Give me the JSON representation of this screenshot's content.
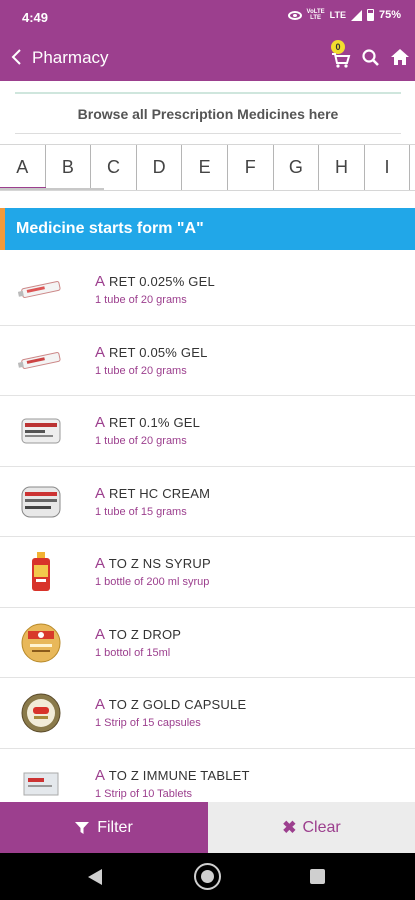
{
  "status_bar": {
    "time": "4:49",
    "network_top": "VoLTE",
    "network_bottom": "LTE",
    "lte": "LTE",
    "battery": "75%"
  },
  "app_bar": {
    "title": "Pharmacy",
    "cart_count": "0"
  },
  "browse": {
    "label": "Browse all Prescription Medicines here"
  },
  "alphabet": [
    "A",
    "B",
    "C",
    "D",
    "E",
    "F",
    "G",
    "H",
    "I"
  ],
  "active_letter": "A",
  "section": {
    "title": "Medicine starts form \"A\""
  },
  "medicines": [
    {
      "first": "A",
      "rest": " RET 0.025% GEL",
      "desc": "1 tube of 20 grams",
      "thumb": "tube-icon"
    },
    {
      "first": "A",
      "rest": " RET 0.05% GEL",
      "desc": "1 tube of 20 grams",
      "thumb": "tube-icon"
    },
    {
      "first": "A",
      "rest": " RET 0.1% GEL",
      "desc": "1 tube of 20 grams",
      "thumb": "box-icon"
    },
    {
      "first": "A",
      "rest": " RET HC CREAM",
      "desc": "1 tube of 15 grams",
      "thumb": "box-icon"
    },
    {
      "first": "A",
      "rest": " TO Z NS SYRUP",
      "desc": "1 bottle of 200 ml syrup",
      "thumb": "bottle-icon"
    },
    {
      "first": "A",
      "rest": " TO Z DROP",
      "desc": "1 bottol of 15ml",
      "thumb": "drop-pack-icon"
    },
    {
      "first": "A",
      "rest": " TO Z GOLD CAPSULE",
      "desc": "1 Strip of 15 capsules",
      "thumb": "capsule-pack-icon"
    },
    {
      "first": "A",
      "rest": " TO Z IMMUNE TABLET",
      "desc": "1 Strip of 10 Tablets",
      "thumb": "tablet-strip-icon"
    }
  ],
  "actions": {
    "filter": "Filter",
    "clear": "Clear"
  },
  "colors": {
    "primary": "#9c3f8e",
    "section_bg": "#21a7e8",
    "section_accent": "#f29a3a",
    "badge": "#f2dd2e"
  }
}
